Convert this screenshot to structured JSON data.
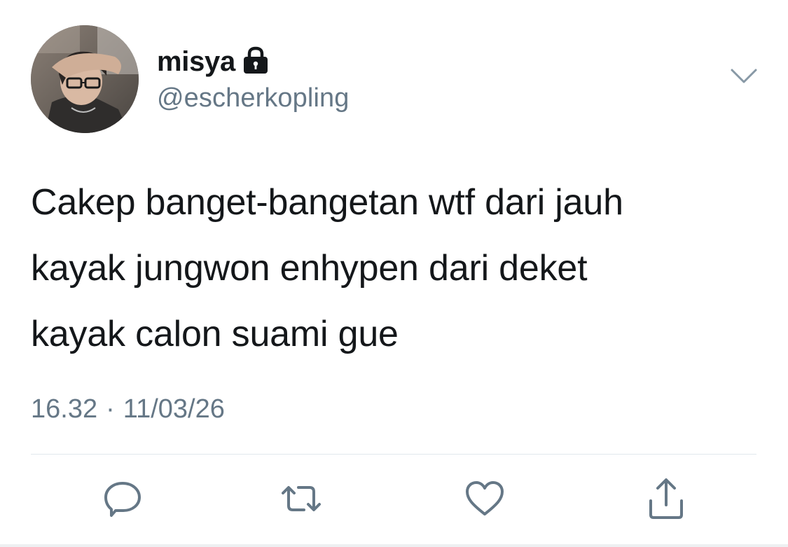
{
  "user": {
    "display_name": "misya",
    "handle": "@escherkopling",
    "protected_icon": "lock-icon",
    "avatar": "user-avatar-photo"
  },
  "tweet": {
    "text": "Cakep banget-bangetan wtf dari jauh\nkayak jungwon enhypen dari deket\nkayak calon suami gue",
    "time": "16.32",
    "separator": "·",
    "date": "11/03/26"
  },
  "menu": {
    "icon": "chevron-down-icon"
  },
  "actions": [
    {
      "name": "reply",
      "icon": "reply-bubble-icon"
    },
    {
      "name": "retweet",
      "icon": "retweet-icon"
    },
    {
      "name": "like",
      "icon": "heart-icon"
    },
    {
      "name": "share",
      "icon": "share-icon"
    }
  ],
  "colors": {
    "text": "#14171a",
    "secondary": "#657786",
    "divider": "#e1e8ed",
    "icon": "#657786"
  }
}
